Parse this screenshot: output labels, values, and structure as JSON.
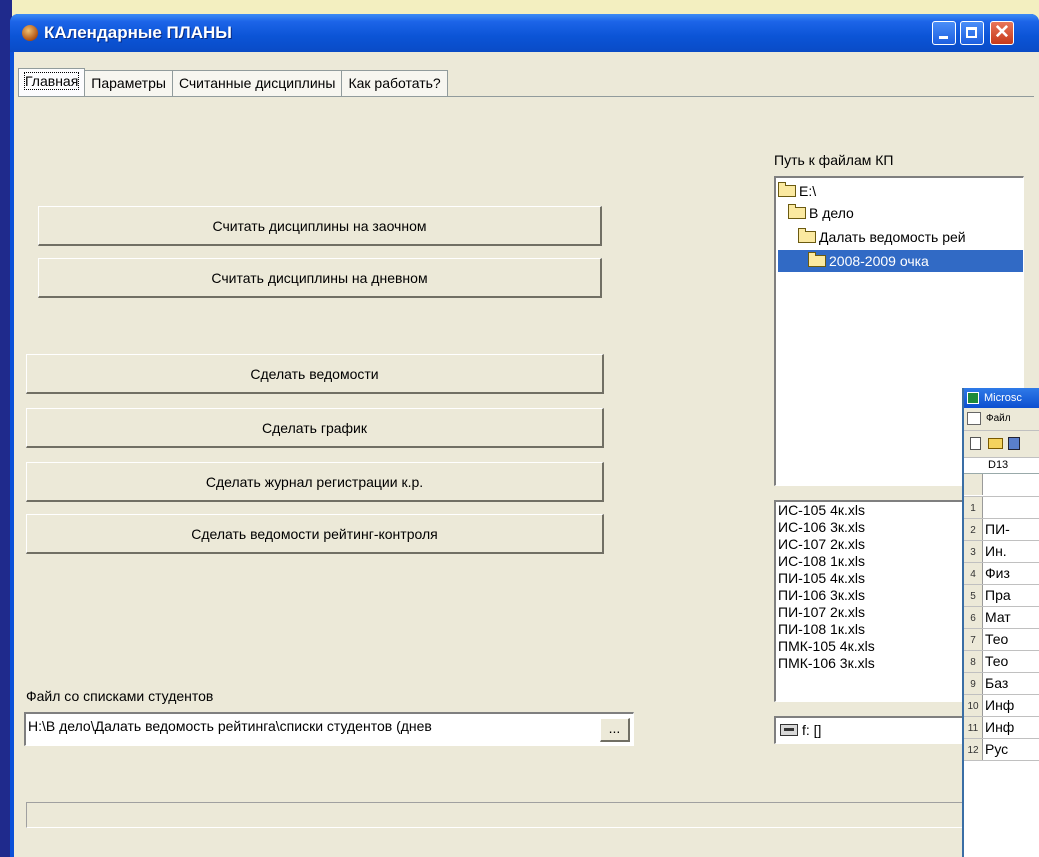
{
  "window": {
    "title": "КАлендарные ПЛАНЫ",
    "minimize_icon": "minimize-icon",
    "maximize_icon": "maximize-icon",
    "close_glyph": "✕"
  },
  "tabs": [
    {
      "label": "Главная",
      "active": true
    },
    {
      "label": "Параметры",
      "active": false
    },
    {
      "label": "Считанные дисциплины",
      "active": false
    },
    {
      "label": "Как работать?",
      "active": false
    }
  ],
  "buttons": {
    "read_correspondence": "Считать дисциплины на заочном",
    "read_daytime": "Считать дисциплины на дневном",
    "make_statements": "Сделать ведомости",
    "make_schedule": "Сделать график",
    "make_registration_log": "Сделать журнал регистрации к.р.",
    "make_rating_statements": "Сделать ведомости рейтинг-контроля"
  },
  "students_file": {
    "label": "Файл со списками студентов",
    "value": "H:\\В дело\\Далать ведомость рейтинга\\списки студентов (днев",
    "browse_label": "..."
  },
  "path_panel": {
    "label": "Путь к файлам КП",
    "tree": [
      {
        "label": "E:\\",
        "selected": false
      },
      {
        "label": "В дело",
        "selected": false
      },
      {
        "label": "Далать ведомость рей",
        "selected": false
      },
      {
        "label": "2008-2009 очка",
        "selected": true
      }
    ],
    "files": [
      "ИС-105 4к.xls",
      "ИС-106 3к.xls",
      "ИС-107 2к.xls",
      "ИС-108 1к.xls",
      "ПИ-105 4к.xls",
      "ПИ-106 3к.xls",
      "ПИ-107 2к.xls",
      "ПИ-108 1к.xls",
      "ПМК-105 4к.xls",
      "ПМК-106 3к.xls"
    ],
    "drive": "f: []"
  },
  "excel": {
    "title": "Microsc",
    "menu_item": "Файл",
    "cell_ref": "D13",
    "rows": [
      {
        "n": "",
        "text": ""
      },
      {
        "n": "1",
        "text": ""
      },
      {
        "n": "2",
        "text": "ПИ-"
      },
      {
        "n": "3",
        "text": "Ин."
      },
      {
        "n": "4",
        "text": "Физ"
      },
      {
        "n": "5",
        "text": "Пра"
      },
      {
        "n": "6",
        "text": "Мат"
      },
      {
        "n": "7",
        "text": "Тео"
      },
      {
        "n": "8",
        "text": "Тео"
      },
      {
        "n": "9",
        "text": "Баз"
      },
      {
        "n": "10",
        "text": "Инф"
      },
      {
        "n": "11",
        "text": "Инф"
      },
      {
        "n": "12",
        "text": "Рус"
      }
    ]
  },
  "colors": {
    "slide_background": "#f3efc0",
    "slide_accent": "#1f2a8c",
    "titlebar": "#0b54d6",
    "selection": "#316ac5"
  }
}
